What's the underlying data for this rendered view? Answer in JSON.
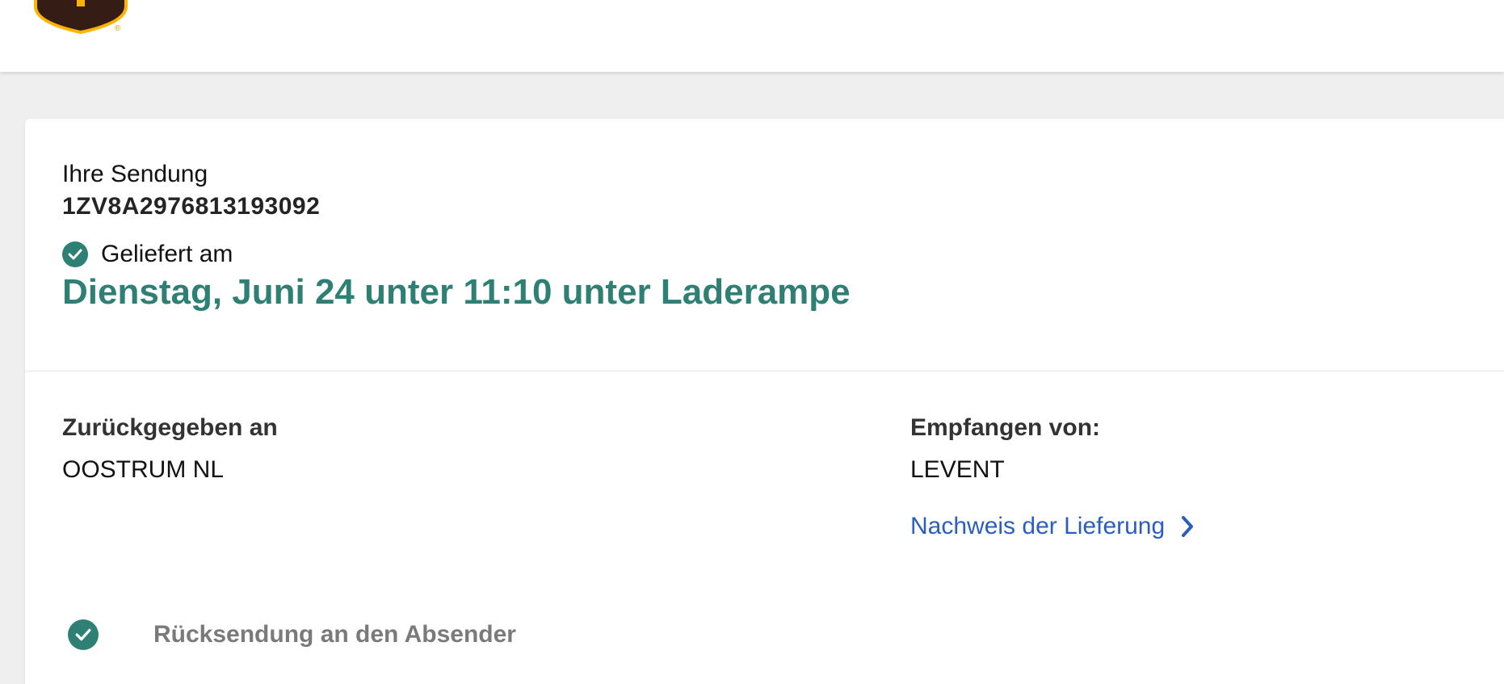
{
  "header": {
    "logo_icon": "ups-shield-logo-icon",
    "brand_colors": {
      "shield": "#351c15",
      "gold": "#ffb500"
    }
  },
  "shipment": {
    "label": "Ihre Sendung",
    "tracking_number": "1ZV8A2976813193092"
  },
  "status": {
    "icon": "check-circle-icon",
    "label": "Geliefert am",
    "headline": "Dienstag, Juni 24 unter 11:10 unter Laderampe",
    "accent_color": "#2f8074"
  },
  "details": {
    "returned_to_heading": "Zurückgegeben an",
    "returned_to_value": "OOSTRUM NL",
    "received_by_heading": "Empfangen von:",
    "received_by_value": "LEVENT",
    "proof_link": "Nachweis der Lieferung",
    "proof_link_icon": "chevron-right-icon",
    "link_color": "#2a5ec0"
  },
  "progress": {
    "step_label": "Rücksendung an den Absender",
    "step_icon": "check-circle-icon"
  }
}
